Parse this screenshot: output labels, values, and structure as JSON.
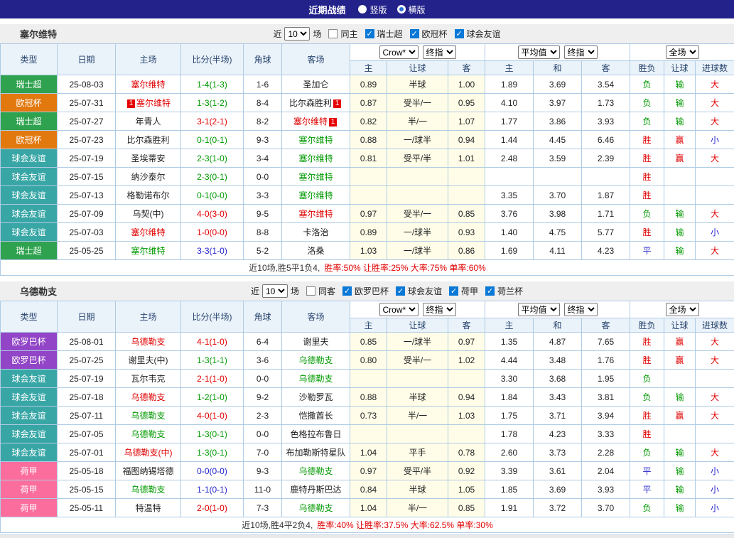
{
  "title": "近期战绩",
  "layout_options": [
    {
      "label": "竖版",
      "selected": false
    },
    {
      "label": "横版",
      "selected": true
    }
  ],
  "filter_labels": {
    "recent": "近",
    "count": "10",
    "matches": "场"
  },
  "table_header": {
    "base_cols": [
      "类型",
      "日期",
      "主场",
      "比分(半场)",
      "角球",
      "客场"
    ],
    "group1": {
      "dropdowns": [
        "Crow*",
        "终指"
      ],
      "cols": [
        "主",
        "让球",
        "客"
      ]
    },
    "group2": {
      "dropdowns": [
        "平均值",
        "终指"
      ],
      "cols": [
        "主",
        "和",
        "客"
      ]
    },
    "group3": {
      "dropdowns": [
        "全场"
      ],
      "cols": [
        "胜负",
        "让球",
        "进球数"
      ]
    }
  },
  "league_colors": {
    "瑞士超": "#2FA24F",
    "欧冠杯": "#E2790F",
    "球会友谊": "#39A6A6",
    "欧罗巴杯": "#9245C6",
    "荷甲": "#FB6D9D"
  },
  "value_colors": {
    "胜": "red",
    "平": "blue",
    "负": "green",
    "赢": "red",
    "输": "green",
    "大": "red",
    "小": "blue"
  },
  "sections": [
    {
      "team": "塞尔维特",
      "venue_filter": {
        "label": "同主",
        "checked": false
      },
      "league_filters": [
        {
          "label": "瑞士超",
          "checked": true
        },
        {
          "label": "欧冠杯",
          "checked": true
        },
        {
          "label": "球会友谊",
          "checked": true
        }
      ],
      "rows": [
        {
          "league": "瑞士超",
          "date": "25-08-03",
          "home": "塞尔维特",
          "home_color": "red",
          "score": "1-4(1-3)",
          "score_color": "green",
          "corner": "1-6",
          "away": "圣加仑",
          "away_color": "black",
          "odds": [
            "0.89",
            "半球",
            "1.00"
          ],
          "avg": [
            "1.89",
            "3.69",
            "3.54"
          ],
          "result": [
            "负",
            "输",
            "大"
          ]
        },
        {
          "league": "欧冠杯",
          "date": "25-07-31",
          "home": "塞尔维特",
          "home_color": "red",
          "home_badge": "1",
          "home_badge_side": "left",
          "score": "1-3(1-2)",
          "score_color": "green",
          "corner": "8-4",
          "away": "比尔森胜利",
          "away_color": "black",
          "away_badge": "1",
          "odds": [
            "0.87",
            "受半/一",
            "0.95"
          ],
          "avg": [
            "4.10",
            "3.97",
            "1.73"
          ],
          "result": [
            "负",
            "输",
            "大"
          ]
        },
        {
          "league": "瑞士超",
          "date": "25-07-27",
          "home": "年青人",
          "home_color": "black",
          "score": "3-1(2-1)",
          "score_color": "red",
          "corner": "8-2",
          "away": "塞尔维特",
          "away_color": "red",
          "away_badge": "1",
          "odds": [
            "0.82",
            "半/一",
            "1.07"
          ],
          "avg": [
            "1.77",
            "3.86",
            "3.93"
          ],
          "result": [
            "负",
            "输",
            "大"
          ]
        },
        {
          "league": "欧冠杯",
          "date": "25-07-23",
          "home": "比尔森胜利",
          "home_color": "black",
          "score": "0-1(0-1)",
          "score_color": "green",
          "corner": "9-3",
          "away": "塞尔维特",
          "away_color": "green",
          "odds": [
            "0.88",
            "一/球半",
            "0.94"
          ],
          "avg": [
            "1.44",
            "4.45",
            "6.46"
          ],
          "result": [
            "胜",
            "赢",
            "小"
          ]
        },
        {
          "league": "球会友谊",
          "date": "25-07-19",
          "home": "圣埃蒂安",
          "home_color": "black",
          "score": "2-3(1-0)",
          "score_color": "green",
          "corner": "3-4",
          "away": "塞尔维特",
          "away_color": "green",
          "odds": [
            "0.81",
            "受平/半",
            "1.01"
          ],
          "avg": [
            "2.48",
            "3.59",
            "2.39"
          ],
          "result": [
            "胜",
            "赢",
            "大"
          ]
        },
        {
          "league": "球会友谊",
          "date": "25-07-15",
          "home": "纳沙泰尔",
          "home_color": "black",
          "score": "2-3(0-1)",
          "score_color": "green",
          "corner": "0-0",
          "away": "塞尔维特",
          "away_color": "green",
          "odds": [
            "",
            "",
            ""
          ],
          "avg": [
            "",
            "",
            ""
          ],
          "result": [
            "胜",
            "",
            ""
          ]
        },
        {
          "league": "球会友谊",
          "date": "25-07-13",
          "home": "格勒诺布尔",
          "home_color": "black",
          "score": "0-1(0-0)",
          "score_color": "green",
          "corner": "3-3",
          "away": "塞尔维特",
          "away_color": "green",
          "odds": [
            "",
            "",
            ""
          ],
          "avg": [
            "3.35",
            "3.70",
            "1.87"
          ],
          "result": [
            "胜",
            "",
            ""
          ]
        },
        {
          "league": "球会友谊",
          "date": "25-07-09",
          "home": "乌契(中)",
          "home_color": "black",
          "score": "4-0(3-0)",
          "score_color": "red",
          "corner": "9-5",
          "away": "塞尔维特",
          "away_color": "red",
          "odds": [
            "0.97",
            "受半/一",
            "0.85"
          ],
          "avg": [
            "3.76",
            "3.98",
            "1.71"
          ],
          "result": [
            "负",
            "输",
            "大"
          ]
        },
        {
          "league": "球会友谊",
          "date": "25-07-03",
          "home": "塞尔维特",
          "home_color": "red",
          "score": "1-0(0-0)",
          "score_color": "red",
          "corner": "8-8",
          "away": "卡洛治",
          "away_color": "black",
          "odds": [
            "0.89",
            "一/球半",
            "0.93"
          ],
          "avg": [
            "1.40",
            "4.75",
            "5.77"
          ],
          "result": [
            "胜",
            "输",
            "小"
          ]
        },
        {
          "league": "瑞士超",
          "date": "25-05-25",
          "home": "塞尔维特",
          "home_color": "green",
          "score": "3-3(1-0)",
          "score_color": "blue",
          "corner": "5-2",
          "away": "洛桑",
          "away_color": "black",
          "odds": [
            "1.03",
            "一/球半",
            "0.86"
          ],
          "avg": [
            "1.69",
            "4.11",
            "4.23"
          ],
          "result": [
            "平",
            "输",
            "大"
          ]
        }
      ],
      "summary": {
        "prefix": "近10场,胜5平1负4,",
        "stats": [
          "胜率:50%",
          "让胜率:25%",
          "大率:75%",
          "单率:60%"
        ]
      }
    },
    {
      "team": "乌德勒支",
      "venue_filter": {
        "label": "同客",
        "checked": false
      },
      "league_filters": [
        {
          "label": "欧罗巴杯",
          "checked": true
        },
        {
          "label": "球会友谊",
          "checked": true
        },
        {
          "label": "荷甲",
          "checked": true
        },
        {
          "label": "荷兰杯",
          "checked": true
        }
      ],
      "rows": [
        {
          "league": "欧罗巴杯",
          "date": "25-08-01",
          "home": "乌德勒支",
          "home_color": "red",
          "score": "4-1(1-0)",
          "score_color": "red",
          "corner": "6-4",
          "away": "谢里夫",
          "away_color": "black",
          "odds": [
            "0.85",
            "一/球半",
            "0.97"
          ],
          "avg": [
            "1.35",
            "4.87",
            "7.65"
          ],
          "result": [
            "胜",
            "赢",
            "大"
          ]
        },
        {
          "league": "欧罗巴杯",
          "date": "25-07-25",
          "home": "谢里夫(中)",
          "home_color": "black",
          "score": "1-3(1-1)",
          "score_color": "green",
          "corner": "3-6",
          "away": "乌德勒支",
          "away_color": "green",
          "odds": [
            "0.80",
            "受半/一",
            "1.02"
          ],
          "avg": [
            "4.44",
            "3.48",
            "1.76"
          ],
          "result": [
            "胜",
            "赢",
            "大"
          ]
        },
        {
          "league": "球会友谊",
          "date": "25-07-19",
          "home": "瓦尔韦克",
          "home_color": "black",
          "score": "2-1(1-0)",
          "score_color": "red",
          "corner": "0-0",
          "away": "乌德勒支",
          "away_color": "green",
          "odds": [
            "",
            "",
            ""
          ],
          "avg": [
            "3.30",
            "3.68",
            "1.95"
          ],
          "result": [
            "负",
            "",
            ""
          ]
        },
        {
          "league": "球会友谊",
          "date": "25-07-18",
          "home": "乌德勒支",
          "home_color": "red",
          "score": "1-2(1-0)",
          "score_color": "green",
          "corner": "9-2",
          "away": "沙勒罗瓦",
          "away_color": "black",
          "odds": [
            "0.88",
            "半球",
            "0.94"
          ],
          "avg": [
            "1.84",
            "3.43",
            "3.81"
          ],
          "result": [
            "负",
            "输",
            "大"
          ]
        },
        {
          "league": "球会友谊",
          "date": "25-07-11",
          "home": "乌德勒支",
          "home_color": "green",
          "score": "4-0(1-0)",
          "score_color": "red",
          "corner": "2-3",
          "away": "恺撒酋长",
          "away_color": "black",
          "odds": [
            "0.73",
            "半/一",
            "1.03"
          ],
          "avg": [
            "1.75",
            "3.71",
            "3.94"
          ],
          "result": [
            "胜",
            "赢",
            "大"
          ]
        },
        {
          "league": "球会友谊",
          "date": "25-07-05",
          "home": "乌德勒支",
          "home_color": "green",
          "score": "1-3(0-1)",
          "score_color": "green",
          "corner": "0-0",
          "away": "色格拉布鲁日",
          "away_color": "black",
          "odds": [
            "",
            "",
            ""
          ],
          "avg": [
            "1.78",
            "4.23",
            "3.33"
          ],
          "result": [
            "胜",
            "",
            ""
          ]
        },
        {
          "league": "球会友谊",
          "date": "25-07-01",
          "home": "乌德勒支(中)",
          "home_color": "red",
          "score": "1-3(0-1)",
          "score_color": "green",
          "corner": "7-0",
          "away": "布加勒斯特星队",
          "away_color": "black",
          "odds": [
            "1.04",
            "平手",
            "0.78"
          ],
          "avg": [
            "2.60",
            "3.73",
            "2.28"
          ],
          "result": [
            "负",
            "输",
            "大"
          ]
        },
        {
          "league": "荷甲",
          "date": "25-05-18",
          "home": "福图纳锡塔德",
          "home_color": "black",
          "score": "0-0(0-0)",
          "score_color": "blue",
          "corner": "9-3",
          "away": "乌德勒支",
          "away_color": "green",
          "odds": [
            "0.97",
            "受平/半",
            "0.92"
          ],
          "avg": [
            "3.39",
            "3.61",
            "2.04"
          ],
          "result": [
            "平",
            "输",
            "小"
          ]
        },
        {
          "league": "荷甲",
          "date": "25-05-15",
          "home": "乌德勒支",
          "home_color": "green",
          "score": "1-1(0-1)",
          "score_color": "blue",
          "corner": "11-0",
          "away": "鹿特丹斯巴达",
          "away_color": "black",
          "odds": [
            "0.84",
            "半球",
            "1.05"
          ],
          "avg": [
            "1.85",
            "3.69",
            "3.93"
          ],
          "result": [
            "平",
            "输",
            "小"
          ]
        },
        {
          "league": "荷甲",
          "date": "25-05-11",
          "home": "特温特",
          "home_color": "black",
          "score": "2-0(1-0)",
          "score_color": "red",
          "corner": "7-3",
          "away": "乌德勒支",
          "away_color": "green",
          "odds": [
            "1.04",
            "半/一",
            "0.85"
          ],
          "avg": [
            "1.91",
            "3.72",
            "3.70"
          ],
          "result": [
            "负",
            "输",
            "小"
          ]
        }
      ],
      "summary": {
        "prefix": "近10场,胜4平2负4,",
        "stats": [
          "胜率:40%",
          "让胜率:37.5%",
          "大率:62.5%",
          "单率:30%"
        ]
      }
    }
  ]
}
